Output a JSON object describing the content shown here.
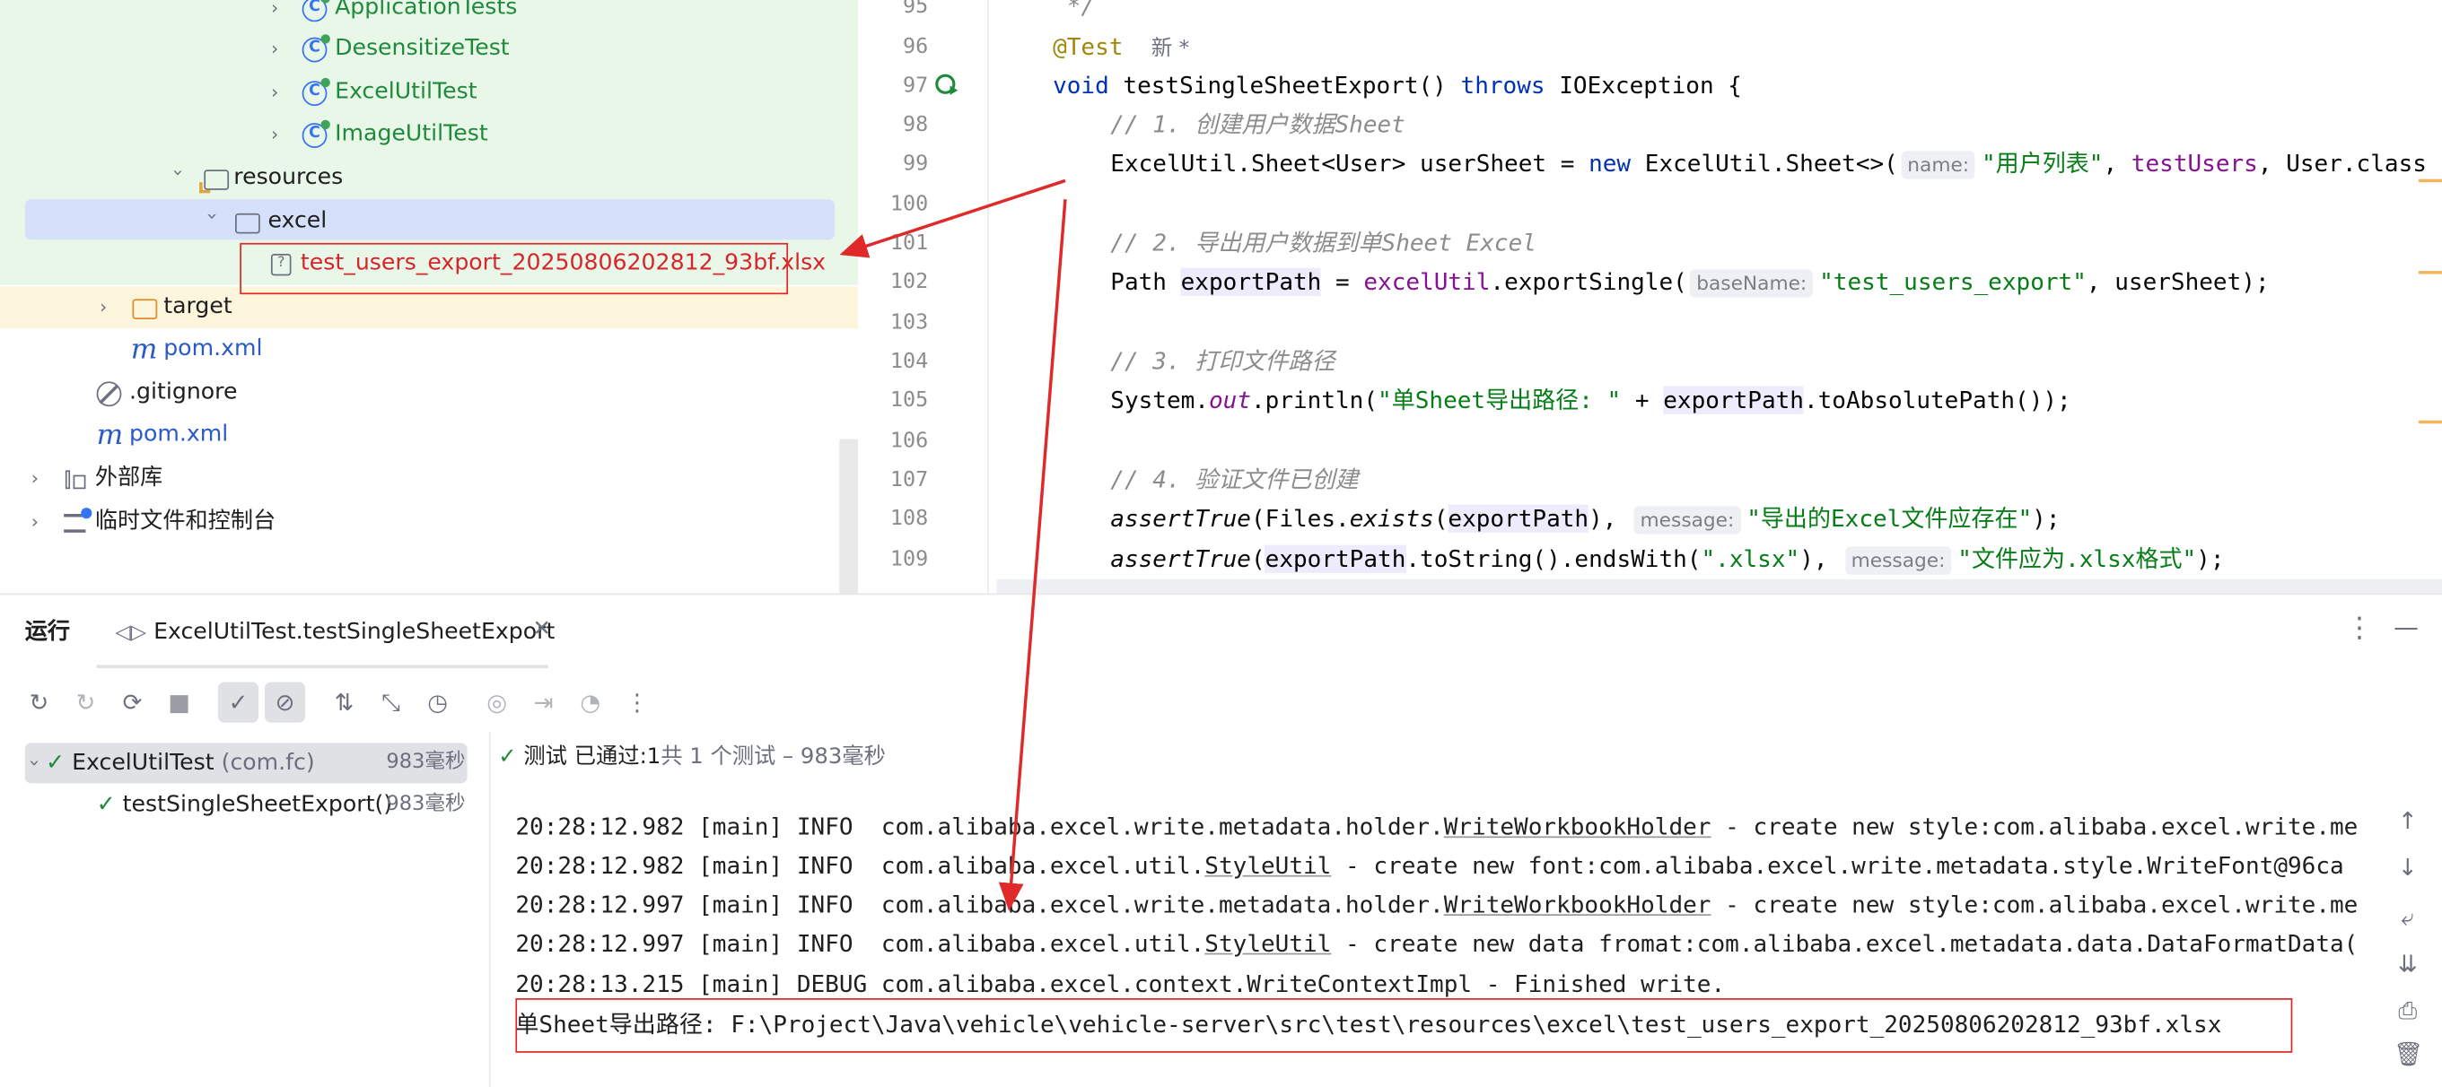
{
  "project_tree": {
    "items": [
      {
        "label": "ApplicationTests",
        "icon": "test-class-icon"
      },
      {
        "label": "DesensitizeTest",
        "icon": "test-class-icon"
      },
      {
        "label": "ExcelUtilTest",
        "icon": "test-class-icon"
      },
      {
        "label": "ImageUtilTest",
        "icon": "test-class-icon"
      },
      {
        "label": "resources",
        "icon": "resources-folder-icon"
      },
      {
        "label": "excel",
        "icon": "folder-icon"
      },
      {
        "label": "test_users_export_20250806202812_93bf.xlsx",
        "icon": "unknown-file-icon"
      },
      {
        "label": "target",
        "icon": "excluded-folder-icon"
      },
      {
        "label": "pom.xml",
        "icon": "maven-icon"
      },
      {
        "label": ".gitignore",
        "icon": "ignored-file-icon"
      },
      {
        "label": "pom.xml",
        "icon": "maven-icon"
      },
      {
        "label": "外部库",
        "icon": "library-icon"
      },
      {
        "label": "临时文件和控制台",
        "icon": "scratches-icon"
      }
    ]
  },
  "editor": {
    "lines": [
      {
        "no": "95",
        "text": " */"
      },
      {
        "no": "96",
        "annotation": "@Test",
        "hint": "新 *"
      },
      {
        "no": "97",
        "kw1": "void",
        "method": " testSingleSheetExport() ",
        "kw2": "throws",
        "rest": " IOException {"
      },
      {
        "no": "98",
        "comment": "// 1. 创建用户数据Sheet"
      },
      {
        "no": "99",
        "a": "ExcelUtil.Sheet<User> userSheet = ",
        "kw": "new",
        "b": " ExcelUtil.Sheet<>(",
        "hint": "name:",
        "str": "\"用户列表\"",
        "c": ", ",
        "fld": "testUsers",
        "d": ", User.class"
      },
      {
        "no": "100",
        "text": ""
      },
      {
        "no": "101",
        "comment": "// 2. 导出用户数据到单Sheet Excel"
      },
      {
        "no": "102",
        "a": "Path ",
        "var": "exportPath",
        "b": " = ",
        "fld": "excelUtil",
        "c": ".exportSingle(",
        "hint": "baseName:",
        "str": "\"test_users_export\"",
        "d": ", userSheet);"
      },
      {
        "no": "103",
        "text": ""
      },
      {
        "no": "104",
        "comment": "// 3. 打印文件路径"
      },
      {
        "no": "105",
        "a": "System.",
        "fld": "out",
        "b": ".println(",
        "str": "\"单Sheet导出路径: \"",
        "c": " + ",
        "var": "exportPath",
        "d": ".toAbsolutePath());"
      },
      {
        "no": "106",
        "text": ""
      },
      {
        "no": "107",
        "comment": "// 4. 验证文件已创建"
      },
      {
        "no": "108",
        "m": "assertTrue",
        "a": "(Files.",
        "m2": "exists",
        "b": "(",
        "var": "exportPath",
        "c": "), ",
        "hint": "message:",
        "str": "\"导出的Excel文件应存在\"",
        "d": ");"
      },
      {
        "no": "109",
        "m": "assertTrue",
        "a": "(",
        "var": "exportPath",
        "b": ".toString().endsWith(",
        "str1": "\".xlsx\"",
        "c": "), ",
        "hint": "message:",
        "str": "\"文件应为.xlsx格式\"",
        "d": ");"
      }
    ]
  },
  "run_panel": {
    "title": "运行",
    "tab_label": "ExcelUtilTest.testSingleSheetExport",
    "tests": [
      {
        "label": "ExcelUtilTest",
        "pkg": "(com.fc)",
        "duration": "983毫秒"
      },
      {
        "label": "testSingleSheetExport()",
        "duration": "983毫秒"
      }
    ],
    "status": {
      "test": "测试",
      "passed": "已通过:",
      "count": "1",
      "total": "共 1 个测试 – 983毫秒"
    },
    "console": [
      {
        "time": "20:28:12.982",
        "level": " [main] INFO  ",
        "pkg": "com.alibaba.excel.write.metadata.holder.",
        "cls": "WriteWorkbookHolder",
        "msg": " - create new style:com.alibaba.excel.write.me"
      },
      {
        "time": "20:28:12.982",
        "level": " [main] INFO  ",
        "pkg": "com.alibaba.excel.util.",
        "cls": "StyleUtil",
        "msg": " - create new font:com.alibaba.excel.write.metadata.style.WriteFont@96ca"
      },
      {
        "time": "20:28:12.997",
        "level": " [main] INFO  ",
        "pkg": "com.alibaba.excel.write.metadata.holder.",
        "cls": "WriteWorkbookHolder",
        "msg": " - create new style:com.alibaba.excel.write.me"
      },
      {
        "time": "20:28:12.997",
        "level": " [main] INFO  ",
        "pkg": "com.alibaba.excel.util.",
        "cls": "StyleUtil",
        "msg": " - create new data fromat:com.alibaba.excel.metadata.data.DataFormatData("
      },
      {
        "time": "20:28:13.215",
        "level": " [main] DEBUG ",
        "pkg": "com.alibaba.excel.context.WriteContextImpl",
        "cls": "",
        "msg": " - Finished write."
      }
    ],
    "output_line": "单Sheet导出路径: F:\\Project\\Java\\vehicle\\vehicle-server\\src\\test\\resources\\excel\\test_users_export_20250806202812_93bf.xlsx"
  },
  "colors": {
    "accent": "#3574f0",
    "annotation_red": "#e02a2a",
    "success": "#208a3c"
  }
}
